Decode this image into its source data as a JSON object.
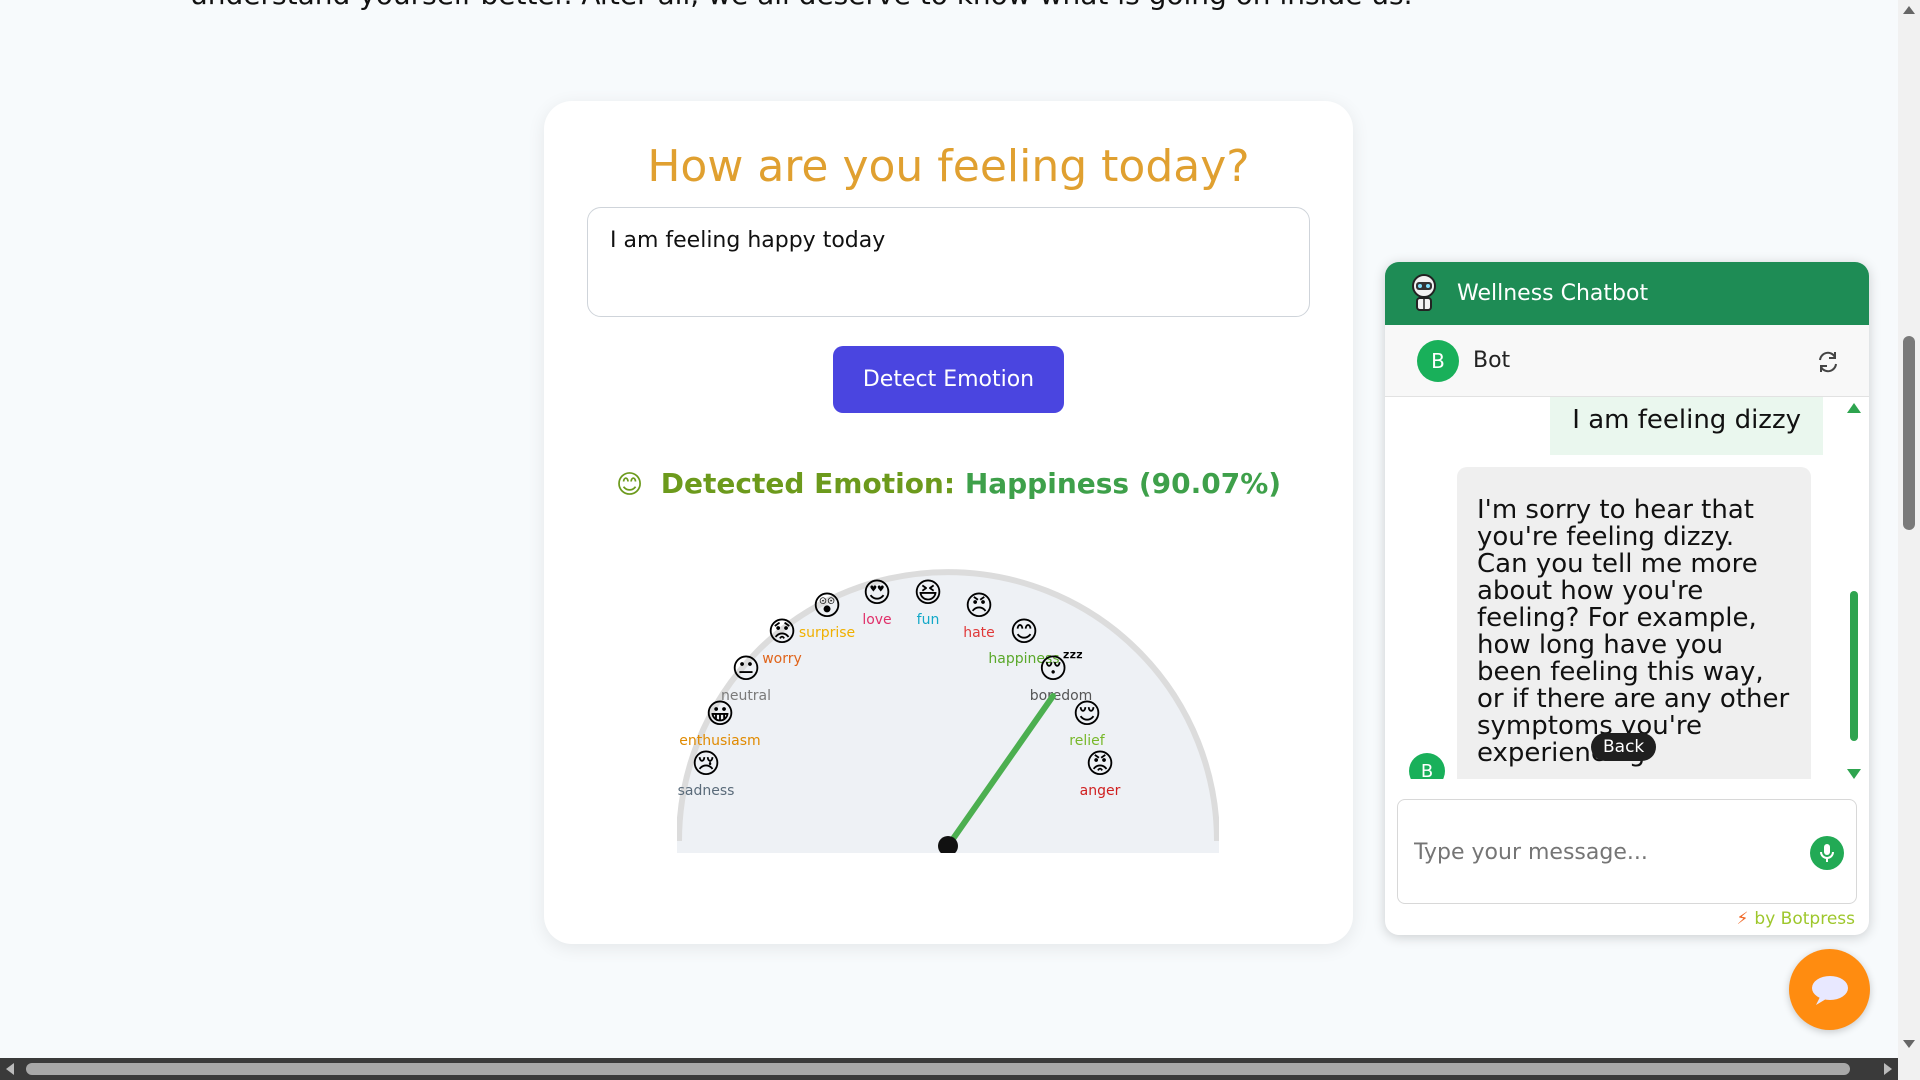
{
  "page": {
    "intro_text": "understand yourself better. After all, we all deserve to know what is going on inside us."
  },
  "emotion_card": {
    "title": "How are you feeling today?",
    "input_value": "I am feeling happy today",
    "detect_button_label": "Detect Emotion",
    "result_icon": "😊",
    "result_label": "Detected Emotion:",
    "result_value": "Happiness (90.07%)",
    "title_color": "#e0a030",
    "button_color": "#4a45e0"
  },
  "gauge": {
    "needle_emotion": "happiness",
    "needle_color": "#4caf50",
    "emotions": [
      {
        "label": "sadness",
        "emoji": "😢",
        "color": "#5a6b7a"
      },
      {
        "label": "enthusiasm",
        "emoji": "😀",
        "color": "#e08a00"
      },
      {
        "label": "neutral",
        "emoji": "😐",
        "color": "#7a7a7a"
      },
      {
        "label": "worry",
        "emoji": "😟",
        "color": "#e0641a"
      },
      {
        "label": "surprise",
        "emoji": "😲",
        "color": "#f0b000"
      },
      {
        "label": "love",
        "emoji": "😍",
        "color": "#e0306a"
      },
      {
        "label": "fun",
        "emoji": "😆",
        "color": "#12a8c8"
      },
      {
        "label": "hate",
        "emoji": "😠",
        "color": "#e03a3a"
      },
      {
        "label": "happiness",
        "emoji": "😊",
        "color": "#5aa82a"
      },
      {
        "label": "boredom",
        "emoji": "😴",
        "color": "#555555"
      },
      {
        "label": "relief",
        "emoji": "😌",
        "color": "#78b82a"
      },
      {
        "label": "anger",
        "emoji": "😡",
        "color": "#d02020"
      }
    ]
  },
  "chat": {
    "header_title": "Wellness Chatbot",
    "bot_avatar_letter": "B",
    "bot_name": "Bot",
    "user_message": "I am feeling dizzy",
    "bot_message": "I'm sorry to hear that you're feeling dizzy. Can you tell me more about how you're feeling? For example, how long have you been feeling this way, or if there are any other symptoms you're experiencing",
    "tooltip": "Back",
    "input_placeholder": "Type your message...",
    "powered_by": "by Botpress",
    "header_color": "#1e8c55",
    "fab_color": "#ff8c10"
  }
}
